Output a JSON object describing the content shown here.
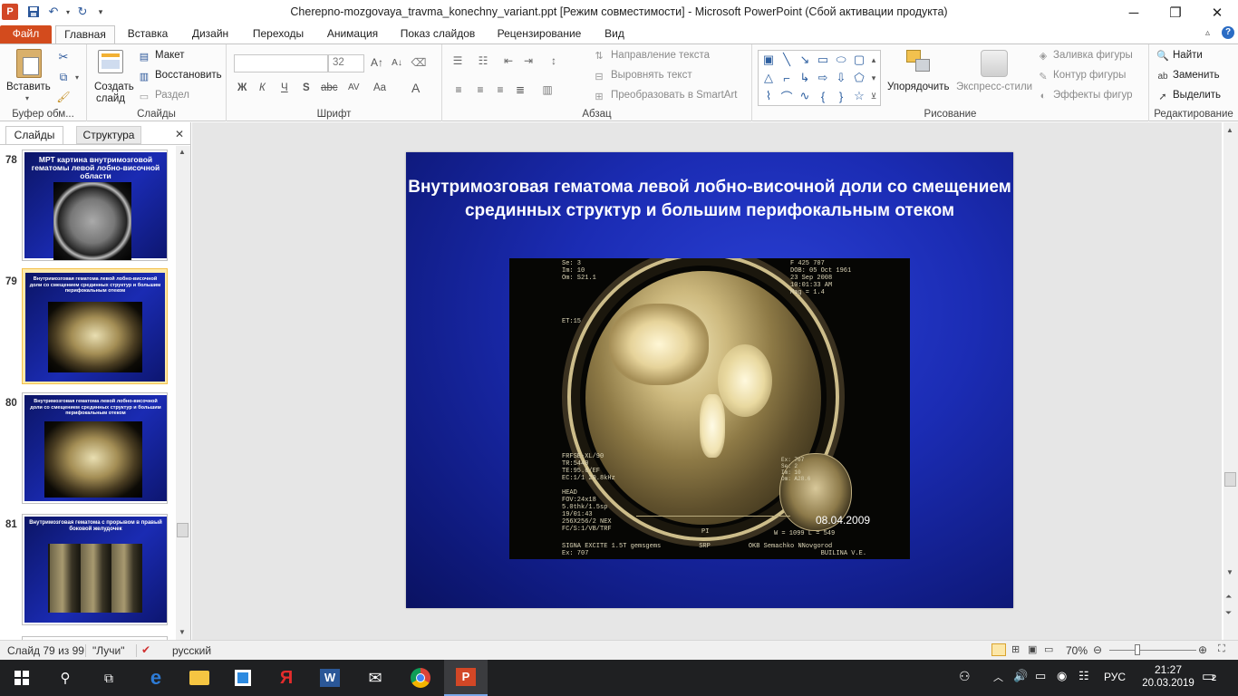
{
  "window": {
    "title": "Cherepno-mozgovaya_travma_konechny_variant.ppt [Режим совместимости]  -  Microsoft PowerPoint (Сбой активации продукта)",
    "minimize": "─",
    "restore": "❐",
    "close": "✕"
  },
  "tabs": [
    {
      "label": "Файл"
    },
    {
      "label": "Главная"
    },
    {
      "label": "Вставка"
    },
    {
      "label": "Дизайн"
    },
    {
      "label": "Переходы"
    },
    {
      "label": "Анимация"
    },
    {
      "label": "Показ слайдов"
    },
    {
      "label": "Рецензирование"
    },
    {
      "label": "Вид"
    }
  ],
  "ribbon": {
    "clipboard": {
      "paste": "Вставить",
      "label": "Буфер обм..."
    },
    "slides": {
      "new_slide": "Создать",
      "new_slide2": "слайд",
      "layout": "Макет",
      "reset": "Восстановить",
      "section": "Раздел",
      "label": "Слайды"
    },
    "font": {
      "size": "32",
      "bold": "Ж",
      "italic": "К",
      "underline": "Ч",
      "shadow": "S",
      "strike": "abc",
      "spacing": "AV",
      "case": "Aa",
      "color": "A",
      "label": "Шрифт"
    },
    "paragraph": {
      "text_direction": "Направление текста",
      "align_text": "Выровнять текст",
      "smartart": "Преобразовать в SmartArt",
      "label": "Абзац"
    },
    "drawing": {
      "arrange": "Упорядочить",
      "quick_styles": "Экспресс-стили",
      "fill": "Заливка фигуры",
      "outline": "Контур фигуры",
      "effects": "Эффекты фигур",
      "label": "Рисование"
    },
    "editing": {
      "find": "Найти",
      "replace": "Заменить",
      "select": "Выделить",
      "label": "Редактирование"
    }
  },
  "panel": {
    "tab_slides": "Слайды",
    "tab_outline": "Структура",
    "close": "✕"
  },
  "thumbnails": [
    {
      "number": "78",
      "title": "МРТ картина внутримозговой гематомы левой лобно-височной области"
    },
    {
      "number": "79",
      "title": "Внутримозговая  гематома  левой лобно-височной доли со смещением  срединных  структур  и большим перифокальным  отеком"
    },
    {
      "number": "80",
      "title": "Внутримозговая  гематома  левой лобно-височной доли со смещением  срединных  структур  и большим перифокальным  отеком"
    },
    {
      "number": "81",
      "title": "Внутримозговая гематома  с прорывом в правый боковой желудочек"
    }
  ],
  "slide": {
    "title": "Внутримозговая  гематома  левой лобно-височной доли со смещением  срединных  структур  и большим перифокальным  отеком",
    "image_date": "08.04.2009",
    "mri_text_top_left": "Se: 3\nIm: 10\nOm: S21.1",
    "mri_text_top_right": "F 425 707\nDOB: 05 Oct 1961\n23 Sep 2008\n10:01:33 AM\nMag = 1.4",
    "mri_text_et": "ET:15",
    "mri_text_params": "FRFSE-XL/90\nTR:5440\nTE:95.6/EF\nEC:1/1 20.8kHz\n\nHEAD\nFOV:24x18\n5.0thk/1.5sp\n19/01:43\n256X256/2 NEX\nFC/S:1/VB/TRF",
    "mri_text_bottom": "SIGNA EXCITE 1.5T gemsgems          SRP          OKB Semachko NNovgorod",
    "mri_text_bottom2": "Ex: 707                                                             BUILINA V.E.",
    "mri_text_wl": "W = 1099 L = 549",
    "mri_text_pi": "PI",
    "mri_text_inset": "Ex: 707\nSe: 2\nIm: 10\nOm: A28.6"
  },
  "status": {
    "slide_info": "Слайд 79 из 99",
    "theme": "\"Лучи\"",
    "language": "русский",
    "zoom": "70%"
  },
  "taskbar": {
    "lang": "РУС",
    "time": "21:27",
    "date": "20.03.2019",
    "notifications": "2"
  }
}
